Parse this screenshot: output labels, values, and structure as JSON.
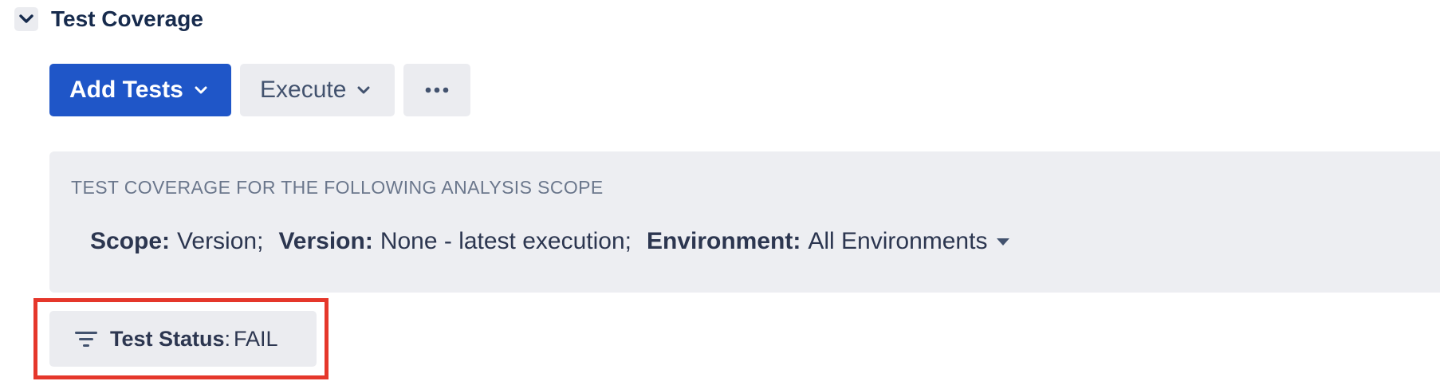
{
  "section": {
    "title": "Test Coverage",
    "toggle_icon": "chevron-down-icon"
  },
  "toolbar": {
    "add_tests_label": "Add Tests",
    "execute_label": "Execute",
    "more_icon": "more-horizontal-icon"
  },
  "scope": {
    "heading": "TEST COVERAGE FOR THE FOLLOWING ANALYSIS SCOPE",
    "scope_label": "Scope:",
    "scope_value": "Version;",
    "version_label": "Version:",
    "version_value": "None - latest execution;",
    "environment_label": "Environment:",
    "environment_value": "All Environments"
  },
  "filter": {
    "icon": "filter-icon",
    "label": "Test Status",
    "separator": ":",
    "value": "FAIL"
  },
  "colors": {
    "primary": "#1f56c8",
    "panel_bg": "#edeef2",
    "button_bg": "#ebecf0",
    "highlight": "#e5372b",
    "text_dark": "#172b4d",
    "text_muted": "#6b778c"
  }
}
